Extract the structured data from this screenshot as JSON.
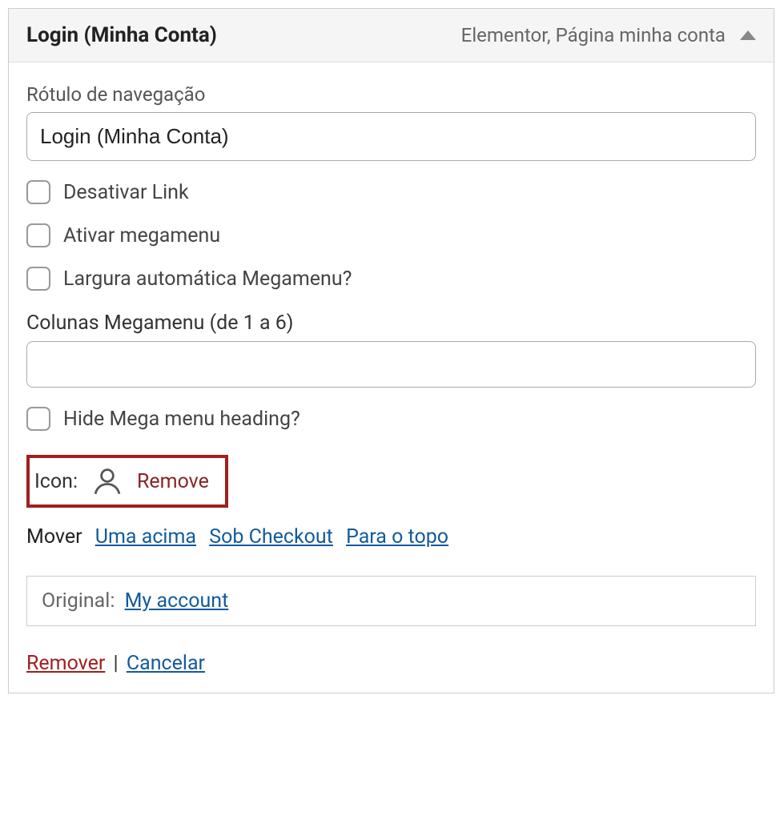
{
  "header": {
    "title": "Login (Minha Conta)",
    "subtitle": "Elementor, Página minha conta"
  },
  "nav_label": {
    "label": "Rótulo de navegação",
    "value": "Login (Minha Conta)"
  },
  "checkboxes": {
    "disable_link": "Desativar Link",
    "enable_megamenu": "Ativar megamenu",
    "auto_width": "Largura automática Megamenu?",
    "hide_heading": "Hide Mega menu heading?"
  },
  "columns": {
    "label": "Colunas Megamenu (de 1 a 6)",
    "value": ""
  },
  "icon": {
    "label": "Icon:",
    "remove": "Remove"
  },
  "move": {
    "label": "Mover",
    "up_one": "Uma acima",
    "under_checkout": "Sob Checkout",
    "to_top": "Para o topo"
  },
  "original": {
    "label": "Original:",
    "link": "My account"
  },
  "footer": {
    "remove": "Remover",
    "cancel": "Cancelar"
  }
}
